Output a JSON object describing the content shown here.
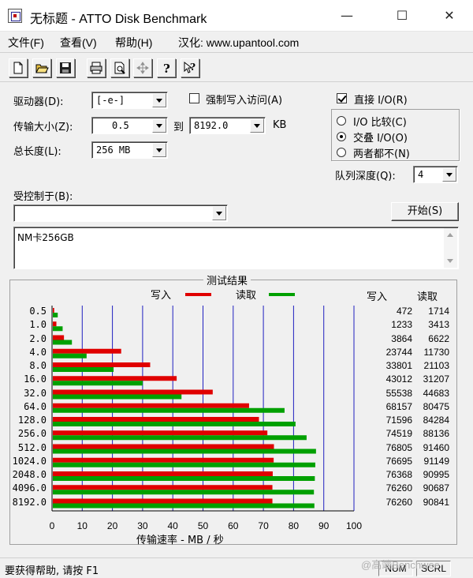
{
  "window": {
    "title": "无标题 - ATTO Disk Benchmark",
    "minimize_glyph": "—",
    "maximize_glyph": "☐",
    "close_glyph": "✕"
  },
  "menu": {
    "file": "文件(F)",
    "view": "查看(V)",
    "help": "帮助(H)",
    "localized": "汉化: www.upantool.com"
  },
  "toolbar_icons": [
    "new-document-icon",
    "open-folder-icon",
    "save-icon",
    "print-icon",
    "print-preview-icon",
    "move-icon",
    "help-icon",
    "context-help-icon"
  ],
  "settings": {
    "drive_label": "驱动器(D):",
    "drive_value": "[-e-]",
    "force_write_label": "强制写入访问(A)",
    "force_write_checked": false,
    "direct_io_label": "直接 I/O(R)",
    "direct_io_checked": true,
    "transfer_label": "传输大小(Z):",
    "transfer_from": "0.5",
    "to_label": "到",
    "transfer_to": "8192.0",
    "kb_unit": "KB",
    "total_length_label": "总长度(L):",
    "total_length_value": "256 MB",
    "io_compare": "I/O 比较(C)",
    "overlapped_io": "交叠 I/O(O)",
    "neither": "两者都不(N)",
    "selected_mode": "overlapped_io",
    "queue_depth_label": "队列深度(Q):",
    "queue_depth_value": "4",
    "controlled_by_label": "受控制于(B):",
    "controlled_by_value": "",
    "start_button": "开始(S)",
    "description_text": "NM卡256GB"
  },
  "results": {
    "title": "测试结果",
    "write_legend": "写入",
    "read_legend": "读取",
    "write_header": "写入",
    "read_header": "读取"
  },
  "chart_data": {
    "type": "bar",
    "orientation": "horizontal",
    "xlabel": "传输速率 - MB / 秒",
    "xlim": [
      0,
      100
    ],
    "xticks": [
      "0",
      "10",
      "20",
      "30",
      "40",
      "50",
      "60",
      "70",
      "80",
      "90",
      "100"
    ],
    "grid": true,
    "categories": [
      "0.5",
      "1.0",
      "2.0",
      "4.0",
      "8.0",
      "16.0",
      "32.0",
      "64.0",
      "128.0",
      "256.0",
      "512.0",
      "1024.0",
      "2048.0",
      "4096.0",
      "8192.0"
    ],
    "series": [
      {
        "name": "写入",
        "color": "#e00000",
        "values": [
          0.45,
          1.18,
          3.69,
          22.64,
          32.24,
          41.02,
          52.96,
          65.0,
          68.27,
          71.06,
          73.24,
          73.14,
          72.83,
          72.73,
          72.73
        ],
        "labels": [
          "472",
          "1233",
          "3864",
          "23744",
          "33801",
          "43012",
          "55538",
          "68157",
          "71596",
          "74519",
          "76805",
          "76695",
          "76368",
          "76260",
          "76260"
        ]
      },
      {
        "name": "读取",
        "color": "#00a000",
        "values": [
          1.63,
          3.25,
          6.32,
          11.19,
          20.12,
          29.76,
          42.62,
          76.75,
          80.38,
          84.05,
          87.17,
          86.93,
          86.78,
          86.48,
          86.63
        ],
        "labels": [
          "1714",
          "3413",
          "6622",
          "11730",
          "21103",
          "31207",
          "44683",
          "80475",
          "84284",
          "88136",
          "91460",
          "91149",
          "90995",
          "90687",
          "90841"
        ]
      }
    ]
  },
  "status": {
    "help_text": "要获得帮助, 请按 F1",
    "num": "NUM",
    "scrl": "SCRL",
    "watermark": "@高端Benchwee"
  }
}
